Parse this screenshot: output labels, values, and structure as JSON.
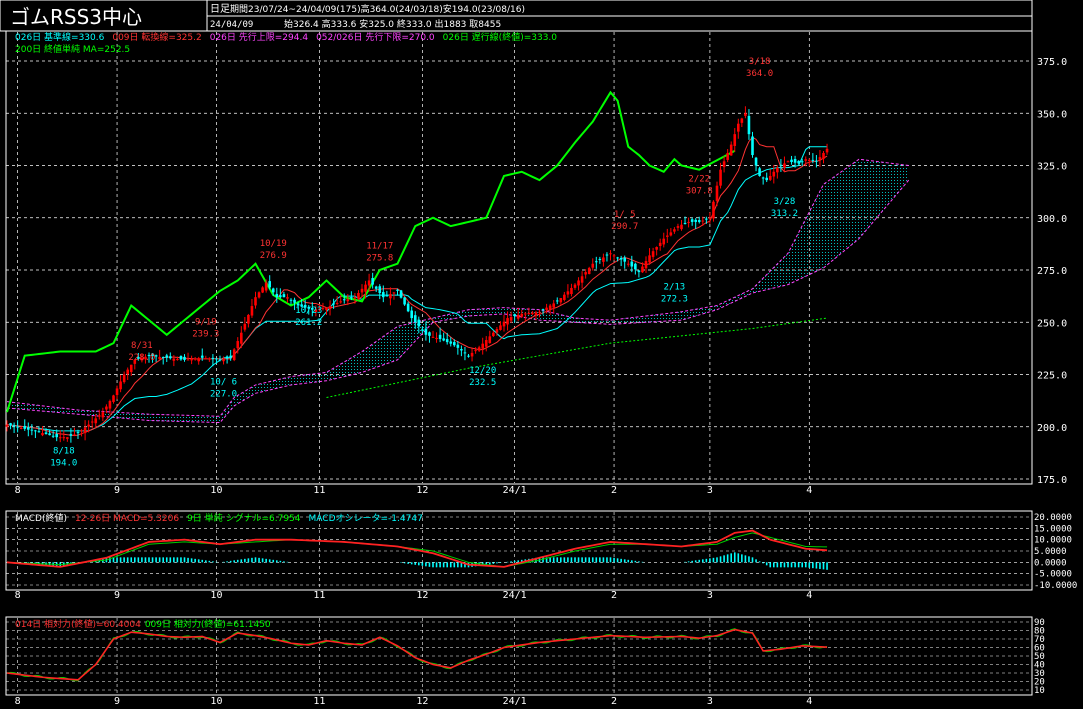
{
  "header": {
    "title": "ゴムRSS3中心",
    "period_label": "日足",
    "period_line": "期間23/07/24~24/04/09(175)高364.0(24/03/18)安194.0(23/08/16)",
    "date": "24/04/09",
    "ohlc_line": "始326.4 高333.6 安325.0 終333.0 出1883 取8455"
  },
  "legend": {
    "line1": [
      {
        "text": "026日 基準線=330.6",
        "color": "#00ffff"
      },
      {
        "text": "009日 転換線=325.2",
        "color": "#ff3333"
      },
      {
        "text": "026日 先行上限=294.4",
        "color": "#ff44ff"
      },
      {
        "text": "052/026日 先行下限=270.0",
        "color": "#ff44ff"
      },
      {
        "text": "026日 遅行線(終値)=333.0",
        "color": "#00ff00"
      }
    ],
    "line2": [
      {
        "text": "200日 終値単純 MA=252.5",
        "color": "#00ff00"
      }
    ]
  },
  "colors": {
    "bull": "#ff0000",
    "bear": "#00ffff",
    "kijun": "#00ffff",
    "tenkan": "#ff3333",
    "chikou": "#00ff00",
    "senkou": "#ff44ff",
    "ma200": "#00ff00",
    "grid": "#ffffff"
  },
  "chart_data": [
    {
      "type": "candlestick",
      "ylim": [
        175,
        375
      ],
      "yticks": [
        "375.0",
        "350.0",
        "325.0",
        "300.0",
        "275.0",
        "250.0",
        "225.0",
        "200.0",
        "175.0"
      ],
      "xticks": [
        {
          "day": 3,
          "label": "8"
        },
        {
          "day": 31,
          "label": "9"
        },
        {
          "day": 59,
          "label": "10"
        },
        {
          "day": 88,
          "label": "11"
        },
        {
          "day": 117,
          "label": "12"
        },
        {
          "day": 143,
          "label": "24/1"
        },
        {
          "day": 171,
          "label": "2"
        },
        {
          "day": 198,
          "label": "3"
        },
        {
          "day": 226,
          "label": "4"
        }
      ],
      "close_anchors": [
        [
          0,
          201
        ],
        [
          5,
          199
        ],
        [
          10,
          197
        ],
        [
          14,
          195
        ],
        [
          17,
          195
        ],
        [
          20,
          197
        ],
        [
          23,
          201
        ],
        [
          27,
          207
        ],
        [
          30,
          215
        ],
        [
          33,
          225
        ],
        [
          36,
          232
        ],
        [
          40,
          234
        ],
        [
          45,
          233
        ],
        [
          50,
          232
        ],
        [
          55,
          233
        ],
        [
          60,
          232
        ],
        [
          63,
          233
        ],
        [
          66,
          245
        ],
        [
          70,
          262
        ],
        [
          73,
          269
        ],
        [
          76,
          262
        ],
        [
          79,
          262
        ],
        [
          82,
          258
        ],
        [
          86,
          256
        ],
        [
          90,
          257
        ],
        [
          94,
          260
        ],
        [
          98,
          262
        ],
        [
          102,
          270
        ],
        [
          106,
          262
        ],
        [
          110,
          265
        ],
        [
          114,
          252
        ],
        [
          118,
          244
        ],
        [
          122,
          242
        ],
        [
          126,
          239
        ],
        [
          130,
          234
        ],
        [
          133,
          238
        ],
        [
          137,
          245
        ],
        [
          141,
          252
        ],
        [
          145,
          254
        ],
        [
          150,
          255
        ],
        [
          155,
          260
        ],
        [
          160,
          268
        ],
        [
          165,
          278
        ],
        [
          170,
          283
        ],
        [
          175,
          278
        ],
        [
          178,
          274
        ],
        [
          181,
          282
        ],
        [
          185,
          290
        ],
        [
          189,
          296
        ],
        [
          192,
          298
        ],
        [
          195,
          298
        ],
        [
          198,
          300
        ],
        [
          201,
          323
        ],
        [
          204,
          335
        ],
        [
          206,
          345
        ],
        [
          208,
          350
        ],
        [
          210,
          330
        ],
        [
          212,
          320
        ],
        [
          214,
          318
        ],
        [
          217,
          324
        ],
        [
          220,
          327
        ],
        [
          223,
          326
        ],
        [
          225,
          328
        ],
        [
          228,
          327
        ],
        [
          231,
          333
        ]
      ],
      "annotations": [
        {
          "day": 16,
          "date": "8/18",
          "value": "194.0",
          "color": "#00ffff",
          "pos": "below"
        },
        {
          "day": 38,
          "date": "8/31",
          "value": "228.0",
          "color": "#ff3333",
          "pos": "above"
        },
        {
          "day": 56,
          "date": "9/19",
          "value": "239.3",
          "color": "#ff3333",
          "pos": "above"
        },
        {
          "day": 61,
          "date": "10/ 6",
          "value": "227.0",
          "color": "#00ffff",
          "pos": "below"
        },
        {
          "day": 75,
          "date": "10/19",
          "value": "276.9",
          "color": "#ff3333",
          "pos": "above"
        },
        {
          "day": 85,
          "date": "10/23",
          "value": "261.2",
          "color": "#00ffff",
          "pos": "below"
        },
        {
          "day": 105,
          "date": "11/17",
          "value": "275.8",
          "color": "#ff3333",
          "pos": "above"
        },
        {
          "day": 134,
          "date": "12/20",
          "value": "232.5",
          "color": "#00ffff",
          "pos": "below"
        },
        {
          "day": 174,
          "date": "1/ 5",
          "value": "290.7",
          "color": "#ff3333",
          "pos": "above"
        },
        {
          "day": 188,
          "date": "2/13",
          "value": "272.3",
          "color": "#00ffff",
          "pos": "below"
        },
        {
          "day": 195,
          "date": "2/22",
          "value": "307.8",
          "color": "#ff3333",
          "pos": "above"
        },
        {
          "day": 212,
          "date": "3/18",
          "value": "364.0",
          "color": "#ff3333",
          "pos": "above"
        },
        {
          "day": 219,
          "date": "3/28",
          "value": "313.2",
          "color": "#00ffff",
          "pos": "below"
        }
      ],
      "ma200_anchors": [
        [
          90,
          214
        ],
        [
          130,
          228
        ],
        [
          170,
          240
        ],
        [
          210,
          247
        ],
        [
          231,
          252
        ]
      ],
      "senkou_a_anchors": [
        [
          0,
          212
        ],
        [
          20,
          208
        ],
        [
          40,
          206
        ],
        [
          60,
          205
        ],
        [
          64,
          214
        ],
        [
          70,
          220
        ],
        [
          80,
          224
        ],
        [
          90,
          226
        ],
        [
          100,
          236
        ],
        [
          110,
          248
        ],
        [
          120,
          252
        ],
        [
          130,
          256
        ],
        [
          140,
          257
        ],
        [
          150,
          256
        ],
        [
          160,
          252
        ],
        [
          170,
          251
        ],
        [
          180,
          253
        ],
        [
          190,
          255
        ],
        [
          200,
          258
        ],
        [
          210,
          266
        ],
        [
          220,
          283
        ],
        [
          230,
          316
        ],
        [
          240,
          328
        ],
        [
          254,
          325
        ]
      ],
      "senkou_b_anchors": [
        [
          0,
          209
        ],
        [
          20,
          206
        ],
        [
          40,
          203
        ],
        [
          60,
          202
        ],
        [
          64,
          210
        ],
        [
          70,
          216
        ],
        [
          80,
          220
        ],
        [
          90,
          222
        ],
        [
          100,
          226
        ],
        [
          110,
          232
        ],
        [
          120,
          250
        ],
        [
          130,
          253
        ],
        [
          140,
          254
        ],
        [
          150,
          251
        ],
        [
          160,
          250
        ],
        [
          170,
          249
        ],
        [
          180,
          250
        ],
        [
          190,
          251
        ],
        [
          200,
          256
        ],
        [
          210,
          264
        ],
        [
          220,
          268
        ],
        [
          230,
          276
        ],
        [
          240,
          290
        ],
        [
          254,
          318
        ]
      ],
      "chikou_anchors": [
        [
          0,
          207
        ],
        [
          5,
          234
        ],
        [
          15,
          236
        ],
        [
          25,
          236
        ],
        [
          30,
          240
        ],
        [
          35,
          258
        ],
        [
          45,
          244
        ],
        [
          55,
          258
        ],
        [
          60,
          265
        ],
        [
          65,
          270
        ],
        [
          70,
          278
        ],
        [
          75,
          263
        ],
        [
          80,
          258
        ],
        [
          85,
          262
        ],
        [
          90,
          270
        ],
        [
          95,
          262
        ],
        [
          100,
          260
        ],
        [
          105,
          275
        ],
        [
          110,
          278
        ],
        [
          115,
          296
        ],
        [
          120,
          300
        ],
        [
          125,
          296
        ],
        [
          130,
          298
        ],
        [
          135,
          300
        ],
        [
          140,
          320
        ],
        [
          145,
          322
        ],
        [
          150,
          318
        ],
        [
          155,
          325
        ],
        [
          160,
          336
        ],
        [
          165,
          346
        ],
        [
          170,
          360
        ],
        [
          172,
          356
        ],
        [
          175,
          334
        ],
        [
          178,
          330
        ],
        [
          181,
          325
        ],
        [
          185,
          322
        ],
        [
          188,
          328
        ],
        [
          190,
          325
        ],
        [
          195,
          323
        ],
        [
          205,
          332
        ]
      ]
    },
    {
      "type": "line",
      "name": "MACD",
      "label_parts": [
        {
          "text": "MACD(終値)",
          "color": "#ffffff"
        },
        {
          "text": "12-26日 MACD=5.3206",
          "color": "#ff3333"
        },
        {
          "text": "9日 単純 シグナル=6.7954",
          "color": "#00ff00"
        },
        {
          "text": "MACDオシレータ=-1.4747",
          "color": "#00ffff"
        }
      ],
      "ylim": [
        -10,
        20
      ],
      "yticks": [
        "20.0000",
        "15.0000",
        "10.0000",
        "5.0000",
        "0.0000",
        "-5.0000",
        "-10.0000"
      ],
      "macd_anchors": [
        [
          0,
          0
        ],
        [
          15,
          -2
        ],
        [
          28,
          2
        ],
        [
          40,
          9
        ],
        [
          50,
          10
        ],
        [
          60,
          8
        ],
        [
          70,
          10
        ],
        [
          80,
          10
        ],
        [
          95,
          9
        ],
        [
          110,
          7
        ],
        [
          120,
          4
        ],
        [
          130,
          -1
        ],
        [
          140,
          -2
        ],
        [
          150,
          2
        ],
        [
          160,
          6
        ],
        [
          170,
          9
        ],
        [
          180,
          8
        ],
        [
          190,
          7
        ],
        [
          200,
          9
        ],
        [
          205,
          13
        ],
        [
          210,
          14
        ],
        [
          215,
          10
        ],
        [
          220,
          8
        ],
        [
          225,
          6
        ],
        [
          231,
          5.3
        ]
      ],
      "signal_anchors": [
        [
          0,
          0
        ],
        [
          15,
          -1
        ],
        [
          28,
          1
        ],
        [
          40,
          8
        ],
        [
          50,
          9
        ],
        [
          60,
          8
        ],
        [
          70,
          9
        ],
        [
          80,
          10
        ],
        [
          95,
          9
        ],
        [
          110,
          7
        ],
        [
          120,
          5
        ],
        [
          130,
          0
        ],
        [
          140,
          -2
        ],
        [
          150,
          1
        ],
        [
          160,
          5
        ],
        [
          170,
          8
        ],
        [
          180,
          8
        ],
        [
          190,
          7
        ],
        [
          200,
          8
        ],
        [
          205,
          11
        ],
        [
          210,
          13
        ],
        [
          215,
          11
        ],
        [
          220,
          9
        ],
        [
          225,
          7
        ],
        [
          231,
          6.8
        ]
      ]
    },
    {
      "type": "line",
      "name": "relative-strength",
      "label_parts": [
        {
          "text": "014日 相対力(終値)=60.4004",
          "color": "#ff3333"
        },
        {
          "text": "009日 相対力(終値)=61.1450",
          "color": "#00ff00"
        }
      ],
      "ylim": [
        10,
        90
      ],
      "yticks": [
        "90",
        "80",
        "70",
        "60",
        "50",
        "40",
        "30",
        "20",
        "10"
      ],
      "rsi_anchors": [
        [
          0,
          30
        ],
        [
          10,
          25
        ],
        [
          20,
          22
        ],
        [
          25,
          40
        ],
        [
          30,
          70
        ],
        [
          35,
          78
        ],
        [
          40,
          76
        ],
        [
          45,
          73
        ],
        [
          50,
          72
        ],
        [
          55,
          73
        ],
        [
          60,
          66
        ],
        [
          65,
          77
        ],
        [
          70,
          74
        ],
        [
          75,
          70
        ],
        [
          80,
          65
        ],
        [
          85,
          63
        ],
        [
          90,
          68
        ],
        [
          95,
          65
        ],
        [
          100,
          63
        ],
        [
          105,
          72
        ],
        [
          110,
          62
        ],
        [
          115,
          48
        ],
        [
          120,
          40
        ],
        [
          125,
          36
        ],
        [
          130,
          45
        ],
        [
          135,
          52
        ],
        [
          140,
          60
        ],
        [
          150,
          66
        ],
        [
          160,
          70
        ],
        [
          170,
          74
        ],
        [
          180,
          72
        ],
        [
          190,
          73
        ],
        [
          195,
          71
        ],
        [
          200,
          74
        ],
        [
          205,
          81
        ],
        [
          210,
          77
        ],
        [
          213,
          56
        ],
        [
          218,
          58
        ],
        [
          224,
          62
        ],
        [
          231,
          60.4
        ]
      ]
    }
  ]
}
